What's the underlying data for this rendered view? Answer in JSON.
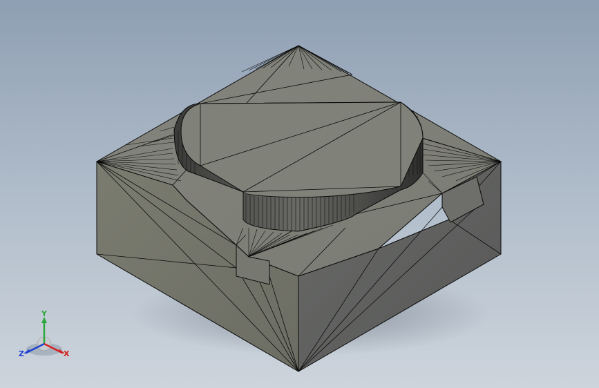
{
  "viewport": {
    "background_top": "#8f9fb3",
    "background_bottom": "#cdd4dc"
  },
  "model": {
    "face_color_top": "#7e7f76",
    "face_color_left": "#75766a",
    "face_color_right": "#5e5f5e",
    "edge_color": "#0a0a0a"
  },
  "triad": {
    "x_label": "X",
    "y_label": "Y",
    "z_label": "Z",
    "x_color": "#d42020",
    "y_color": "#2aa83a",
    "z_color": "#2040d0"
  }
}
